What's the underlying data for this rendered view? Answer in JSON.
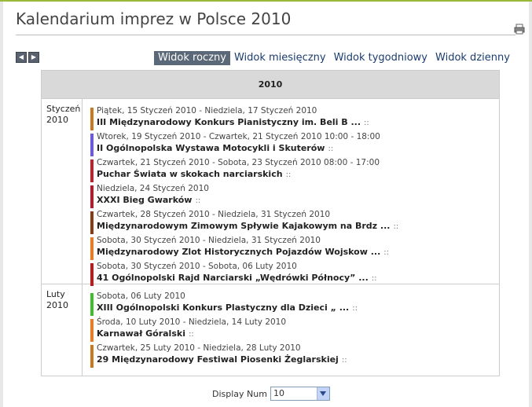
{
  "page": {
    "title": "Kalendarium imprez w Polsce 2010"
  },
  "icons": {
    "print": "printer-icon",
    "prev": "arrow-left-icon",
    "next": "arrow-right-icon",
    "dropdown": "chevron-down-icon"
  },
  "colors": {
    "accent": "#9ab83a",
    "active_tab": "#5b6878",
    "link": "#1a3c6e"
  },
  "views": [
    {
      "label": "Widok roczny",
      "active": true
    },
    {
      "label": "Widok miesięczny",
      "active": false
    },
    {
      "label": "Widok tygodniowy",
      "active": false
    },
    {
      "label": "Widok dzienny",
      "active": false
    }
  ],
  "calendar": {
    "year_header": "2010",
    "months": [
      {
        "label_line1": "Styczeń",
        "label_line2": "2010",
        "events": [
          {
            "date": "Piątek, 15 Styczeń 2010 - Niedziela, 17 Styczeń 2010",
            "name": "III Międzynarodowy Konkurs Pianistyczny im. Beli B ...",
            "color": "#c8781e"
          },
          {
            "date": "Wtorek, 19 Styczeń 2010 - Czwartek, 21 Styczeń 2010 10:00 - 18:00",
            "name": "II Ogólnopolska Wystawa Motocykli i Skuterów",
            "color": "#6a5ae6"
          },
          {
            "date": "Czwartek, 21 Styczeń 2010 - Sobota, 23 Styczeń 2010 08:00 - 17:00",
            "name": "Puchar Świata w skokach narciarskich",
            "color": "#c0202a"
          },
          {
            "date": "Niedziela, 24 Styczeń 2010",
            "name": "XXXI Bieg Gwarków",
            "color": "#b8182a"
          },
          {
            "date": "Czwartek, 28 Styczeń 2010 - Niedziela, 31 Styczeń 2010",
            "name": "Międzynarodowym Zimowym Spływie Kajakowym na Brdz ...",
            "color": "#8a3a10"
          },
          {
            "date": "Sobota, 30 Styczeń 2010 - Niedziela, 31 Styczeń 2010",
            "name": "Międzynarodowy Zlot Historycznych Pojazdów Wojskow ...",
            "color": "#f07a20"
          },
          {
            "date": "Sobota, 30 Styczeń 2010 - Sobota, 06 Luty 2010",
            "name": "41 Ogólnopolski Rajd Narciarski „Wędrówki Północy” ...",
            "color": "#c01818"
          }
        ]
      },
      {
        "label_line1": "Luty",
        "label_line2": "2010",
        "events": [
          {
            "date": "Sobota, 06 Luty 2010",
            "name": "XIII Ogólnopolski Konkurs Plastyczny dla Dzieci „ ...",
            "color": "#3cbf28"
          },
          {
            "date": "Środa, 10 Luty 2010 - Niedziela, 14 Luty 2010",
            "name": "Karnawał Góralski",
            "color": "#f07a20"
          },
          {
            "date": "Czwartek, 25 Luty 2010 - Niedziela, 28 Luty 2010",
            "name": "29 Międzynarodowy Festiwal Piosenki Żeglarskiej",
            "color": "#c8781e"
          }
        ]
      }
    ]
  },
  "separator": "::",
  "footer": {
    "display_label": "Display Num",
    "display_value": "10"
  }
}
